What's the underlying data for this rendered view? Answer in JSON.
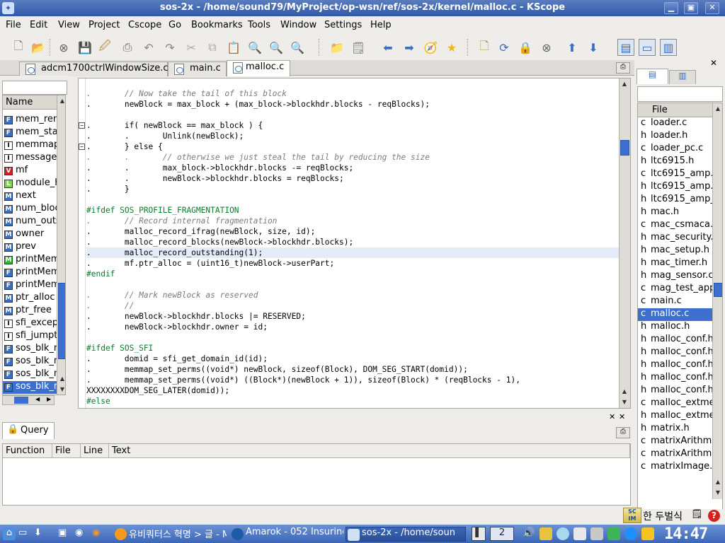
{
  "window": {
    "title": "sos-2x - /home/sound79/MyProject/op-wsn/ref/sos-2x/kernel/malloc.c - KScope"
  },
  "menubar": [
    "File",
    "Edit",
    "View",
    "Project",
    "Cscope",
    "Go",
    "Bookmarks",
    "Tools",
    "Window",
    "Settings",
    "Help"
  ],
  "tabs": [
    {
      "label": "adcm1700ctrlWindowSize.c",
      "active": false
    },
    {
      "label": "main.c",
      "active": false
    },
    {
      "label": "malloc.c",
      "active": true
    }
  ],
  "symbols": {
    "header": "Name",
    "items": [
      {
        "type": "F",
        "name": "mem_rem",
        "color": "#3a6ec0"
      },
      {
        "type": "F",
        "name": "mem_star",
        "color": "#3a6ec0"
      },
      {
        "type": "I",
        "name": "memmap",
        "color": "#ffffff"
      },
      {
        "type": "I",
        "name": "message_",
        "color": "#ffffff"
      },
      {
        "type": "V",
        "name": "mf",
        "color": "#d81f1f"
      },
      {
        "type": "L",
        "name": "module_h",
        "color": "#7fd44a"
      },
      {
        "type": "M",
        "name": "next",
        "color": "#3a6ec0"
      },
      {
        "type": "M",
        "name": "num_bloc",
        "color": "#3a6ec0"
      },
      {
        "type": "M",
        "name": "num_outs",
        "color": "#3a6ec0"
      },
      {
        "type": "M",
        "name": "owner",
        "color": "#3a6ec0"
      },
      {
        "type": "M",
        "name": "prev",
        "color": "#3a6ec0"
      },
      {
        "type": "M",
        "name": "printMem",
        "color": "#2eb82e"
      },
      {
        "type": "F",
        "name": "printMem",
        "color": "#3a6ec0"
      },
      {
        "type": "F",
        "name": "printMem",
        "color": "#3a6ec0"
      },
      {
        "type": "M",
        "name": "ptr_alloc",
        "color": "#3a6ec0"
      },
      {
        "type": "M",
        "name": "ptr_free",
        "color": "#3a6ec0"
      },
      {
        "type": "I",
        "name": "sfi_except",
        "color": "#ffffff"
      },
      {
        "type": "I",
        "name": "sfi_jumpta",
        "color": "#ffffff"
      },
      {
        "type": "F",
        "name": "sos_blk_m",
        "color": "#3a6ec0"
      },
      {
        "type": "F",
        "name": "sos_blk_m",
        "color": "#3a6ec0"
      },
      {
        "type": "F",
        "name": "sos_blk_m",
        "color": "#3a6ec0"
      },
      {
        "type": "F",
        "name": "sos_blk_m",
        "color": "#3a6ec0",
        "selected": true
      }
    ]
  },
  "code": [
    {
      "text": ".       // Now take the tail of this block",
      "cls": "c-comment"
    },
    {
      "text": ".       newBlock = max_block + (max_block->blockhdr.blocks - reqBlocks);"
    },
    {
      "text": ""
    },
    {
      "text": ".       if( newBlock == max_block ) {",
      "fold": "-",
      "kw": true
    },
    {
      "text": ".       .       Unlink(newBlock);"
    },
    {
      "text": ".       } else {",
      "fold": "-"
    },
    {
      "text": ".       .       // otherwise we just steal the tail by reducing the size",
      "cls": "c-comment"
    },
    {
      "text": ".       .       max_block->blockhdr.blocks -= reqBlocks;"
    },
    {
      "text": ".       .       newBlock->blockhdr.blocks = reqBlocks;"
    },
    {
      "text": ".       }"
    },
    {
      "text": ""
    },
    {
      "text": "#ifdef SOS_PROFILE_FRAGMENTATION",
      "cls": "c-pre"
    },
    {
      "text": ".       // Record internal fragmentation",
      "cls": "c-comment"
    },
    {
      "text": ".       malloc_record_ifrag(newBlock, size, id);"
    },
    {
      "text": ".       malloc_record_blocks(newBlock->blockhdr.blocks);"
    },
    {
      "text": ".       malloc_record_outstanding(1);",
      "hl": true
    },
    {
      "text": ".       mf.ptr_alloc = (uint16_t)newBlock->userPart;"
    },
    {
      "text": "#endif",
      "cls": "c-pre"
    },
    {
      "text": ""
    },
    {
      "text": ".       // Mark newBlock as reserved",
      "cls": "c-comment"
    },
    {
      "text": ".       //",
      "cls": "c-comment"
    },
    {
      "text": ".       newBlock->blockhdr.blocks |= RESERVED;"
    },
    {
      "text": ".       newBlock->blockhdr.owner = id;"
    },
    {
      "text": ""
    },
    {
      "text": "#ifdef SOS_SFI",
      "cls": "c-pre"
    },
    {
      "text": ".       domid = sfi_get_domain_id(id);"
    },
    {
      "text": ".       memmap_set_perms((void*) newBlock, sizeof(Block), DOM_SEG_START(domid));"
    },
    {
      "text": ".       memmap_set_perms((void*) ((Block*)(newBlock + 1)), sizeof(Block) * (reqBlocks - 1),"
    },
    {
      "text": "XXXXXXXXDOM_SEG_LATER(domid));"
    },
    {
      "text": "#else",
      "cls": "c-pre"
    }
  ],
  "files": {
    "header": "File",
    "items": [
      {
        "t": "c",
        "name": "loader.c"
      },
      {
        "t": "h",
        "name": "loader.h"
      },
      {
        "t": "c",
        "name": "loader_pc.c"
      },
      {
        "t": "h",
        "name": "ltc6915.h"
      },
      {
        "t": "c",
        "name": "ltc6915_amp."
      },
      {
        "t": "h",
        "name": "ltc6915_amp."
      },
      {
        "t": "h",
        "name": "ltc6915_amp_"
      },
      {
        "t": "h",
        "name": "mac.h"
      },
      {
        "t": "c",
        "name": "mac_csmaca.h"
      },
      {
        "t": "h",
        "name": "mac_security."
      },
      {
        "t": "h",
        "name": "mac_setup.h"
      },
      {
        "t": "h",
        "name": "mac_timer.h"
      },
      {
        "t": "h",
        "name": "mag_sensor.c"
      },
      {
        "t": "c",
        "name": "mag_test_app"
      },
      {
        "t": "c",
        "name": "main.c"
      },
      {
        "t": "c",
        "name": "malloc.c",
        "selected": true
      },
      {
        "t": "h",
        "name": "malloc.h"
      },
      {
        "t": "h",
        "name": "malloc_conf.h"
      },
      {
        "t": "h",
        "name": "malloc_conf.h"
      },
      {
        "t": "h",
        "name": "malloc_conf.h"
      },
      {
        "t": "h",
        "name": "malloc_conf.h"
      },
      {
        "t": "h",
        "name": "malloc_conf.h"
      },
      {
        "t": "c",
        "name": "malloc_extmen"
      },
      {
        "t": "h",
        "name": "malloc_extmen"
      },
      {
        "t": "h",
        "name": "matrix.h"
      },
      {
        "t": "c",
        "name": "matrixArithme"
      },
      {
        "t": "c",
        "name": "matrixArithme"
      },
      {
        "t": "c",
        "name": "matrixImage.c"
      }
    ]
  },
  "query": {
    "tab_label": "Query",
    "columns": [
      "Function",
      "File",
      "Line",
      "Text"
    ]
  },
  "ime": {
    "label": "한 두벌식"
  },
  "taskbar": {
    "tasks": [
      {
        "label": "유비쿼터스 혁명 > 글 - M",
        "active": false
      },
      {
        "label": "Amarok - 052 Insuring",
        "active": false
      },
      {
        "label": "sos-2x - /home/soun",
        "active": true
      }
    ],
    "desktop_num": "2",
    "clock": "14:47"
  }
}
